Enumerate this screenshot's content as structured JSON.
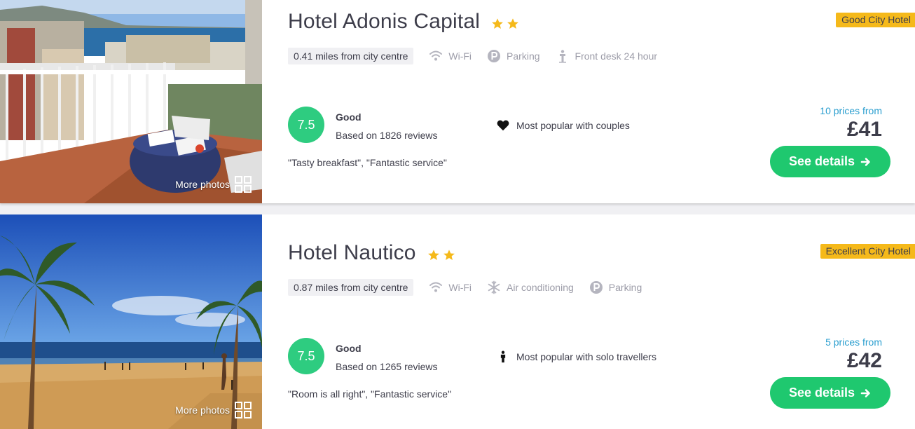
{
  "hotels": [
    {
      "name": "Hotel Adonis Capital",
      "stars": 2,
      "badge": "Good City Hotel",
      "distance": "0.41 miles from city centre",
      "amenities": [
        {
          "icon": "wifi-icon",
          "label": "Wi-Fi"
        },
        {
          "icon": "parking-icon",
          "label": "Parking"
        },
        {
          "icon": "front-desk-icon",
          "label": "Front desk 24 hour"
        }
      ],
      "rating": "7.5",
      "rating_word": "Good",
      "reviews": "Based on 1826 reviews",
      "quotes": "\"Tasty breakfast\", \"Fantastic service\"",
      "popular_icon": "heart-icon",
      "popular": "Most popular with couples",
      "prices_from": "10 prices from",
      "price": "£41",
      "cta": "See details",
      "more_photos": "More photos"
    },
    {
      "name": "Hotel Nautico",
      "stars": 2,
      "badge": "Excellent City Hotel",
      "distance": "0.87 miles from city centre",
      "amenities": [
        {
          "icon": "wifi-icon",
          "label": "Wi-Fi"
        },
        {
          "icon": "snowflake-icon",
          "label": "Air conditioning"
        },
        {
          "icon": "parking-icon",
          "label": "Parking"
        }
      ],
      "rating": "7.5",
      "rating_word": "Good",
      "reviews": "Based on 1265 reviews",
      "quotes": "\"Room is all right\", \"Fantastic service\"",
      "popular_icon": "person-icon",
      "popular": "Most popular with solo travellers",
      "prices_from": "5 prices from",
      "price": "£42",
      "cta": "See details",
      "more_photos": "More photos"
    }
  ],
  "colors": {
    "rating_green": "#2ecc80",
    "cta_green": "#1fc86f",
    "badge_yellow": "#f5b91a",
    "star_yellow": "#f5b91a",
    "link_blue": "#2a9ecf"
  }
}
